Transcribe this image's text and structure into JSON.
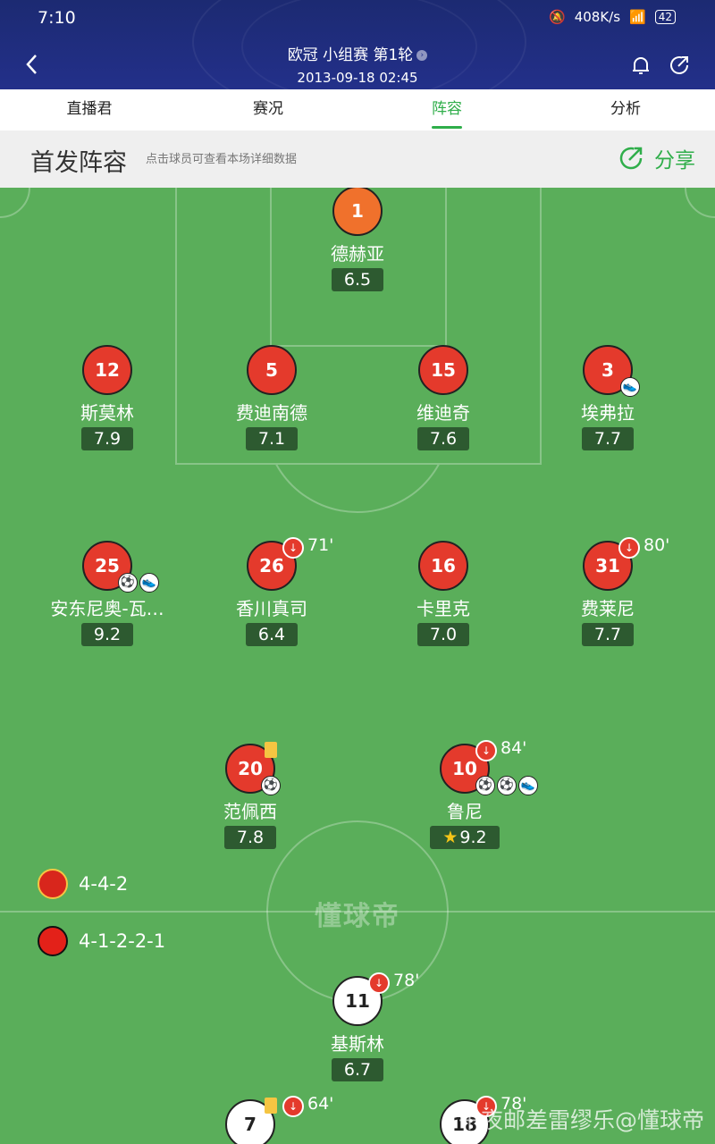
{
  "status": {
    "time": "7:10",
    "speed": "408K/s",
    "battery": "42"
  },
  "header": {
    "match_title": "欧冠 小组赛 第1轮",
    "datetime": "2013-09-18 02:45"
  },
  "tabs": [
    {
      "label": "直播君",
      "active": false
    },
    {
      "label": "赛况",
      "active": false
    },
    {
      "label": "阵容",
      "active": true
    },
    {
      "label": "分析",
      "active": false
    }
  ],
  "section": {
    "title": "首发阵容",
    "hint": "点击球员可查看本场详细数据",
    "share_label": "分享"
  },
  "players": {
    "p1": {
      "number": "1",
      "name": "德赫亚",
      "rating": "6.5"
    },
    "p12": {
      "number": "12",
      "name": "斯莫林",
      "rating": "7.9"
    },
    "p5": {
      "number": "5",
      "name": "费迪南德",
      "rating": "7.1"
    },
    "p15": {
      "number": "15",
      "name": "维迪奇",
      "rating": "7.6"
    },
    "p3": {
      "number": "3",
      "name": "埃弗拉",
      "rating": "7.7"
    },
    "p25": {
      "number": "25",
      "name": "安东尼奥-瓦…",
      "rating": "9.2"
    },
    "p26": {
      "number": "26",
      "name": "香川真司",
      "rating": "6.4",
      "sub_time": "71'"
    },
    "p16": {
      "number": "16",
      "name": "卡里克",
      "rating": "7.0"
    },
    "p31": {
      "number": "31",
      "name": "费莱尼",
      "rating": "7.7",
      "sub_time": "80'"
    },
    "p20": {
      "number": "20",
      "name": "范佩西",
      "rating": "7.8"
    },
    "p10": {
      "number": "10",
      "name": "鲁尼",
      "rating": "9.2",
      "sub_time": "84'"
    },
    "p11": {
      "number": "11",
      "name": "基斯林",
      "rating": "6.7",
      "sub_time": "78'"
    },
    "p7": {
      "number": "7",
      "sub_time": "64'"
    },
    "p18": {
      "number": "18",
      "sub_time": "78'"
    }
  },
  "formations": {
    "home": "4-4-2",
    "away": "4-1-2-2-1"
  },
  "watermark": "懂球帝",
  "corner_watermark": "午夜邮差雷缪乐@懂球帝"
}
